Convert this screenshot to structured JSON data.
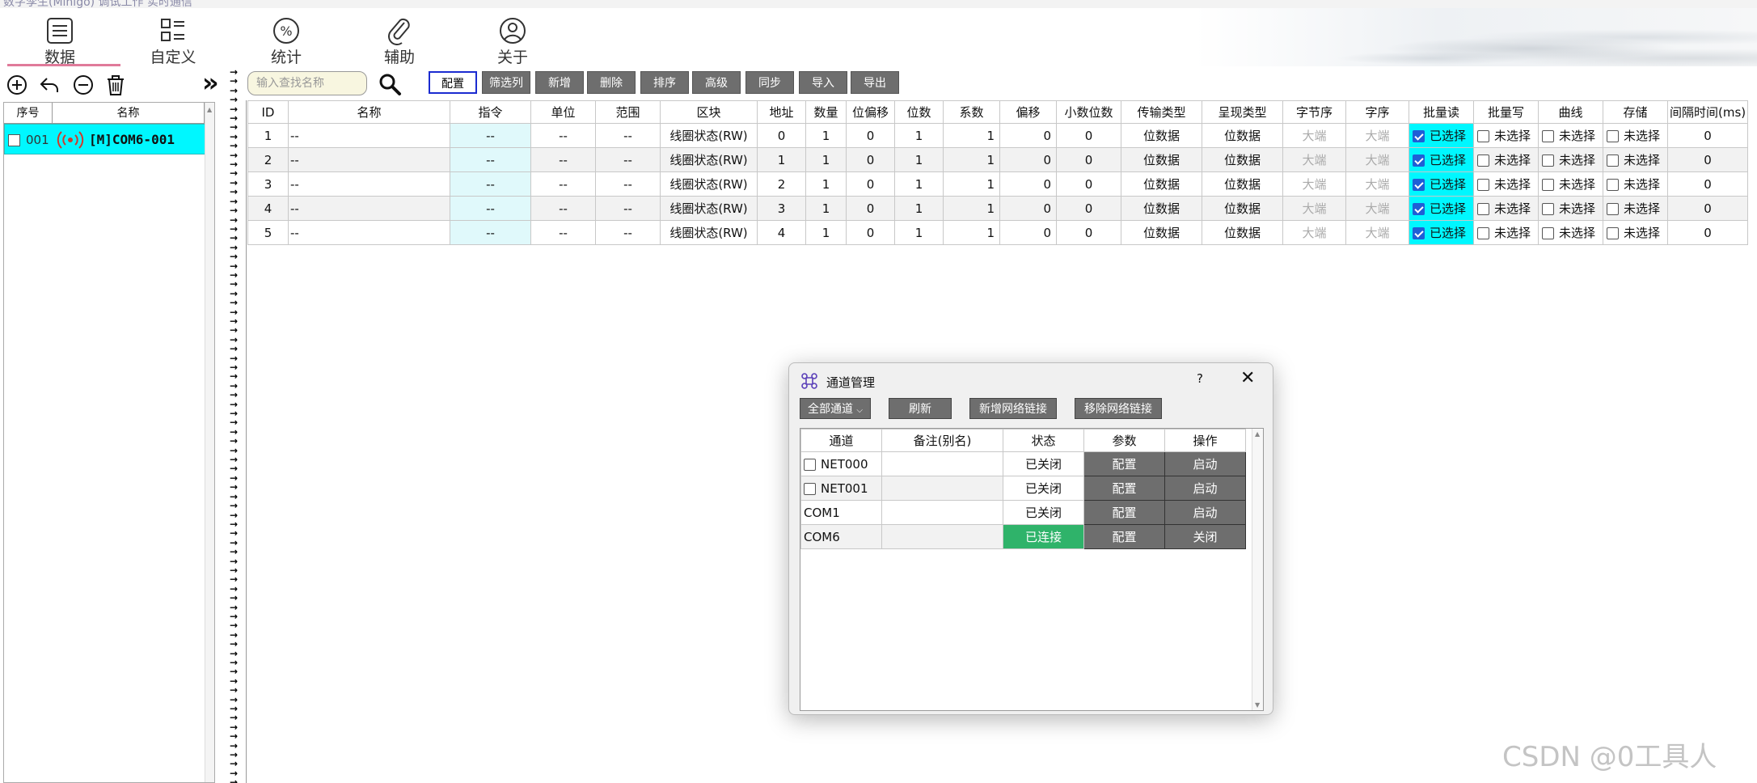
{
  "window": {
    "title": "数字孪生(Mihigo) 调试工作 实时通信"
  },
  "ribbon": {
    "tabs": [
      {
        "label": "数据",
        "icon": "list-icon"
      },
      {
        "label": "自定义",
        "icon": "layout-icon"
      },
      {
        "label": "统计",
        "icon": "percent-icon"
      },
      {
        "label": "辅助",
        "icon": "paperclip-icon"
      },
      {
        "label": "关于",
        "icon": "user-icon"
      }
    ]
  },
  "left_toolbar": {
    "expand_label": "»"
  },
  "tree": {
    "columns": [
      "序号",
      "名称"
    ],
    "rows": [
      {
        "index": "001",
        "name": "[M]COM6-001"
      }
    ]
  },
  "toolbar": {
    "search_placeholder": "输入查找名称",
    "buttons": [
      "配置",
      "筛选列",
      "新增",
      "删除",
      "排序",
      "高级",
      "同步",
      "导入",
      "导出"
    ]
  },
  "grid": {
    "columns": [
      "ID",
      "名称",
      "指令",
      "单位",
      "范围",
      "区块",
      "地址",
      "数量",
      "位偏移",
      "位数",
      "系数",
      "偏移",
      "小数位数",
      "传输类型",
      "呈现类型",
      "字节序",
      "字序",
      "批量读",
      "批量写",
      "曲线",
      "存储",
      "间隔时间(ms)"
    ],
    "rows": [
      {
        "id": "1",
        "name": "--",
        "cmd": "--",
        "unit": "--",
        "range": "--",
        "block": "线圈状态(RW)",
        "addr": "0",
        "count": "1",
        "bitoff": "0",
        "bits": "1",
        "coef": "1",
        "offset": "0",
        "decimals": "0",
        "trans": "位数据",
        "present": "位数据",
        "byteorder": "大端",
        "wordorder": "大端",
        "bread": "已选择",
        "bwrite": "未选择",
        "curve": "未选择",
        "store": "未选择",
        "interval": "0"
      },
      {
        "id": "2",
        "name": "--",
        "cmd": "--",
        "unit": "--",
        "range": "--",
        "block": "线圈状态(RW)",
        "addr": "1",
        "count": "1",
        "bitoff": "0",
        "bits": "1",
        "coef": "1",
        "offset": "0",
        "decimals": "0",
        "trans": "位数据",
        "present": "位数据",
        "byteorder": "大端",
        "wordorder": "大端",
        "bread": "已选择",
        "bwrite": "未选择",
        "curve": "未选择",
        "store": "未选择",
        "interval": "0"
      },
      {
        "id": "3",
        "name": "--",
        "cmd": "--",
        "unit": "--",
        "range": "--",
        "block": "线圈状态(RW)",
        "addr": "2",
        "count": "1",
        "bitoff": "0",
        "bits": "1",
        "coef": "1",
        "offset": "0",
        "decimals": "0",
        "trans": "位数据",
        "present": "位数据",
        "byteorder": "大端",
        "wordorder": "大端",
        "bread": "已选择",
        "bwrite": "未选择",
        "curve": "未选择",
        "store": "未选择",
        "interval": "0"
      },
      {
        "id": "4",
        "name": "--",
        "cmd": "--",
        "unit": "--",
        "range": "--",
        "block": "线圈状态(RW)",
        "addr": "3",
        "count": "1",
        "bitoff": "0",
        "bits": "1",
        "coef": "1",
        "offset": "0",
        "decimals": "0",
        "trans": "位数据",
        "present": "位数据",
        "byteorder": "大端",
        "wordorder": "大端",
        "bread": "已选择",
        "bwrite": "未选择",
        "curve": "未选择",
        "store": "未选择",
        "interval": "0"
      },
      {
        "id": "5",
        "name": "--",
        "cmd": "--",
        "unit": "--",
        "range": "--",
        "block": "线圈状态(RW)",
        "addr": "4",
        "count": "1",
        "bitoff": "0",
        "bits": "1",
        "coef": "1",
        "offset": "0",
        "decimals": "0",
        "trans": "位数据",
        "present": "位数据",
        "byteorder": "大端",
        "wordorder": "大端",
        "bread": "已选择",
        "bwrite": "未选择",
        "curve": "未选择",
        "store": "未选择",
        "interval": "0"
      }
    ]
  },
  "dialog": {
    "title": "通道管理",
    "help": "?",
    "close": "✕",
    "filter_label": "全部通道",
    "buttons": [
      "刷新",
      "新增网络链接",
      "移除网络链接"
    ],
    "columns": [
      "通道",
      "备注(别名)",
      "状态",
      "参数",
      "操作"
    ],
    "rows": [
      {
        "channel": "NET000",
        "checkbox": true,
        "alias": "",
        "status": "已关闭",
        "status_on": false,
        "param": "配置",
        "action": "启动"
      },
      {
        "channel": "NET001",
        "checkbox": true,
        "alias": "",
        "status": "已关闭",
        "status_on": false,
        "param": "配置",
        "action": "启动"
      },
      {
        "channel": "COM1",
        "checkbox": false,
        "alias": "",
        "status": "已关闭",
        "status_on": false,
        "param": "配置",
        "action": "启动"
      },
      {
        "channel": "COM6",
        "checkbox": false,
        "alias": "",
        "status": "已连接",
        "status_on": true,
        "param": "配置",
        "action": "关闭"
      }
    ]
  },
  "watermark": "CSDN @0工具人",
  "colors": {
    "selection_cyan": "#00f7ff",
    "button_gray": "#6e6e6e",
    "connected_green": "#2fb36a",
    "focus_blue": "#1b2bd0"
  }
}
